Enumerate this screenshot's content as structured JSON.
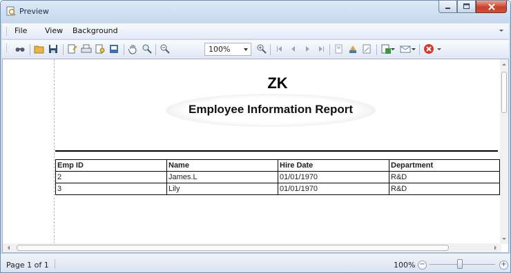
{
  "window": {
    "title": "Preview"
  },
  "menu": {
    "file": "File",
    "view": "View",
    "background": "Background"
  },
  "toolbar": {
    "zoom_value": "100%"
  },
  "report": {
    "company": "ZK",
    "title": "Employee Information Report",
    "columns": [
      "Emp ID",
      "Name",
      "Hire Date",
      "Department"
    ],
    "rows": [
      [
        "2",
        "James.L",
        "01/01/1970",
        "R&D"
      ],
      [
        "3",
        "Lily",
        "01/01/1970",
        "R&D"
      ]
    ]
  },
  "status": {
    "page_info": "Page 1 of 1",
    "zoom": "100%",
    "zoom_level_percent": 100
  },
  "colors": {
    "titlebar": "#dde9f6",
    "close_button": "#c7412c",
    "toolbar": "#e4ecf6"
  },
  "icons": [
    "find-icon",
    "open-icon",
    "save-icon",
    "page-setup-icon",
    "print-icon",
    "print-preview-icon",
    "export-icon",
    "hand-icon",
    "magnifier-icon",
    "zoom-out-icon",
    "zoom-in-icon",
    "first-page-icon",
    "previous-page-icon",
    "next-page-icon",
    "last-page-icon",
    "fill-background-icon",
    "watermark-icon",
    "edit-page-header-icon",
    "export-document-icon",
    "send-email-icon",
    "close-preview-icon"
  ]
}
